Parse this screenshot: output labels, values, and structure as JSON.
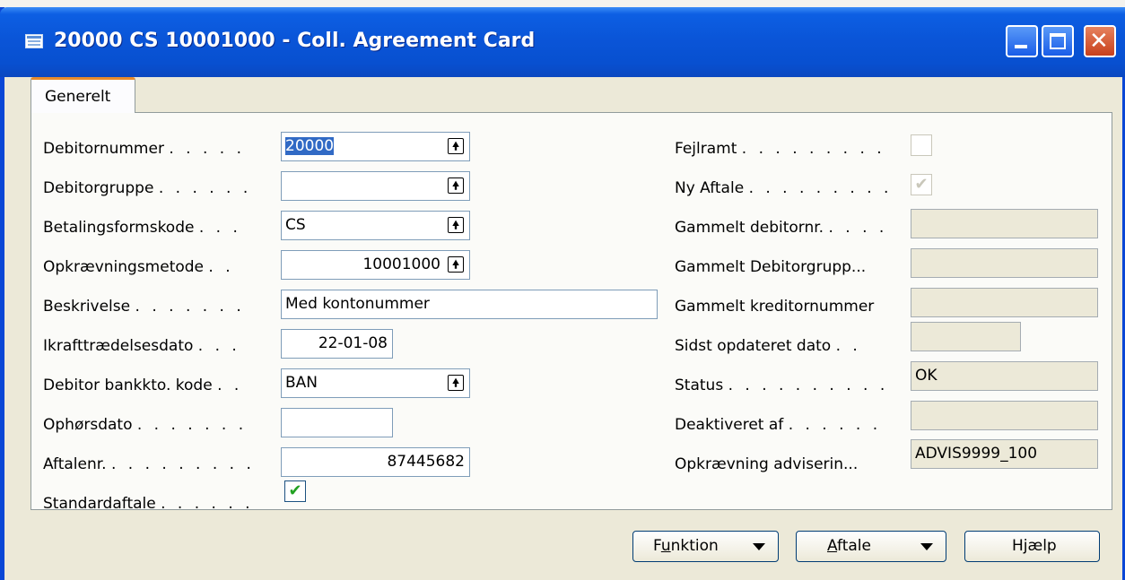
{
  "window": {
    "title": "20000 CS 10001000 - Coll. Agreement Card"
  },
  "tabs": [
    {
      "label": "Generelt"
    }
  ],
  "left_fields": {
    "debitornummer": {
      "label": "Debitornummer",
      "dots": ". . . . .",
      "value": "20000"
    },
    "debitorgruppe": {
      "label": "Debitorgruppe",
      "dots": ". . . . . .",
      "value": ""
    },
    "betalingsformskode": {
      "label": "Betalingsformskode",
      "dots": ". . .",
      "value": "CS"
    },
    "opkraevningsmetode": {
      "label": "Opkrævningsmetode",
      "dots": ". .",
      "value": "10001000"
    },
    "beskrivelse": {
      "label": "Beskrivelse",
      "dots": ". . . . . . .",
      "value": "Med kontonummer"
    },
    "ikrafttraedelsesdato": {
      "label": "Ikrafttrædelsesdato",
      "dots": ". . .",
      "value": "22-01-08"
    },
    "debitor_bankkto_kode": {
      "label": "Debitor bankkto. kode",
      "dots": ". .",
      "value": "BAN"
    },
    "ophoersdato": {
      "label": "Ophørsdato",
      "dots": ". . . . . . .",
      "value": ""
    },
    "aftalenr": {
      "label": "Aftalenr.",
      "dots": ". . . . . . . . .",
      "value": "87445682"
    },
    "standardaftale": {
      "label": "Standardaftale",
      "dots": ". . . . . .",
      "checked": true
    }
  },
  "right_fields": {
    "fejlramt": {
      "label": "Fejlramt",
      "dots": ". . . . . . . . .",
      "checked": false
    },
    "ny_aftale": {
      "label": "Ny Aftale",
      "dots": ". . . . . . . . .",
      "checked": true
    },
    "gammelt_debitornr": {
      "label": "Gammelt debitornr.",
      "dots": ". . . .",
      "value": ""
    },
    "gammelt_debitorgrupp": {
      "label": "Gammelt Debitorgrupp...",
      "dots": "",
      "value": ""
    },
    "gammelt_kreditornummer": {
      "label": "Gammelt kreditornummer",
      "dots": "",
      "value": ""
    },
    "sidst_opdateret_dato": {
      "label": "Sidst opdateret dato",
      "dots": ". .",
      "value": ""
    },
    "status": {
      "label": "Status",
      "dots": ". . . . . . . . . .",
      "value": "OK"
    },
    "deaktiveret_af": {
      "label": "Deaktiveret af",
      "dots": ". . . . . .",
      "value": ""
    },
    "opkraevning_adviserin": {
      "label": "Opkrævning adviserin...",
      "dots": "",
      "value": "ADVIS9999_100"
    }
  },
  "buttons": {
    "funktion": {
      "pre": "F",
      "ul": "u",
      "post": "nktion"
    },
    "aftale": {
      "pre": "",
      "ul": "A",
      "post": "ftale"
    },
    "hjaelp": {
      "label": "Hjælp"
    }
  },
  "icons": {
    "lookup": "arrow-up-box-icon",
    "check": "checkmark-icon",
    "dropdown": "triangle-down-icon"
  },
  "colors": {
    "titlebar": "#0a55d8",
    "selection": "#316ac5",
    "tab_accent": "#e68b2c",
    "check": "#21a121"
  }
}
